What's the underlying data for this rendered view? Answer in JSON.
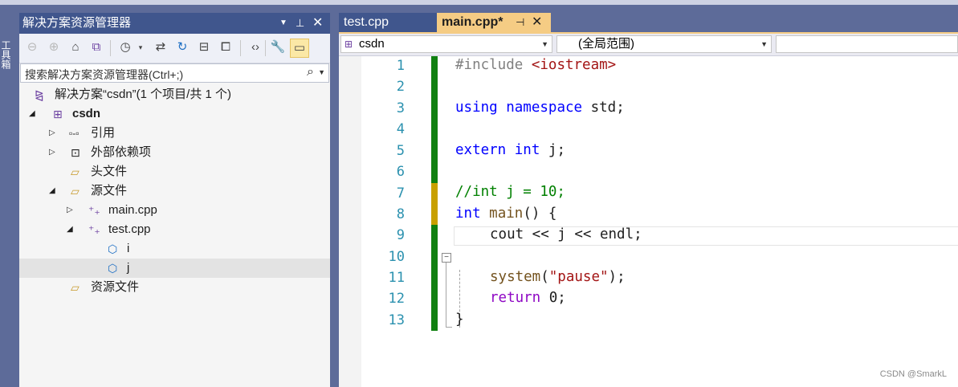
{
  "toolbox": {
    "label": "工具箱"
  },
  "solution_explorer": {
    "title": "解决方案资源管理器",
    "search_placeholder": "搜索解决方案资源管理器(Ctrl+;)",
    "tree": [
      {
        "label": "解决方案“csdn”(1 个项目/共 1 个)",
        "icon": "solution-icon"
      },
      {
        "label": "csdn",
        "icon": "project-icon"
      },
      {
        "label": "引用",
        "icon": "references-icon"
      },
      {
        "label": "外部依赖项",
        "icon": "external-deps-icon"
      },
      {
        "label": "头文件",
        "icon": "filter-folder-icon"
      },
      {
        "label": "源文件",
        "icon": "filter-folder-icon"
      },
      {
        "label": "main.cpp",
        "icon": "cpp-file-icon"
      },
      {
        "label": "test.cpp",
        "icon": "cpp-file-icon"
      },
      {
        "label": "i",
        "icon": "variable-icon"
      },
      {
        "label": "j",
        "icon": "variable-icon"
      },
      {
        "label": "资源文件",
        "icon": "filter-folder-icon"
      }
    ]
  },
  "editor": {
    "tabs": [
      {
        "label": "test.cpp",
        "active": false
      },
      {
        "label": "main.cpp*",
        "active": true
      }
    ],
    "nav": {
      "project": "csdn",
      "scope": "(全局范围)"
    },
    "line_numbers": [
      "1",
      "2",
      "3",
      "4",
      "5",
      "6",
      "7",
      "8",
      "9",
      "10",
      "11",
      "12",
      "13"
    ],
    "code": {
      "l1_directive": "#include",
      "l1_header": "<iostream>",
      "l3_kw1": "using",
      "l3_kw2": "namespace",
      "l3_rest": " std;",
      "l5_kw1": "extern",
      "l5_kw2": "int",
      "l5_rest": " j;",
      "l7_comment": "//int j = 10;",
      "l8_kw": "int",
      "l8_fn": "main",
      "l8_rest": "() {",
      "l9": "cout << j << endl;",
      "l11_fn": "system",
      "l11_str": "\"pause\"",
      "l11_open": "(",
      "l11_close": ");",
      "l12_kw": "return",
      "l12_rest": " 0;",
      "l13": "}"
    }
  },
  "watermark": "CSDN @SmarkL",
  "colors": {
    "title_bar": "#40568d",
    "active_tab": "#f5cc84",
    "saved_change": "#108010",
    "unsaved_change": "#c8a000"
  }
}
